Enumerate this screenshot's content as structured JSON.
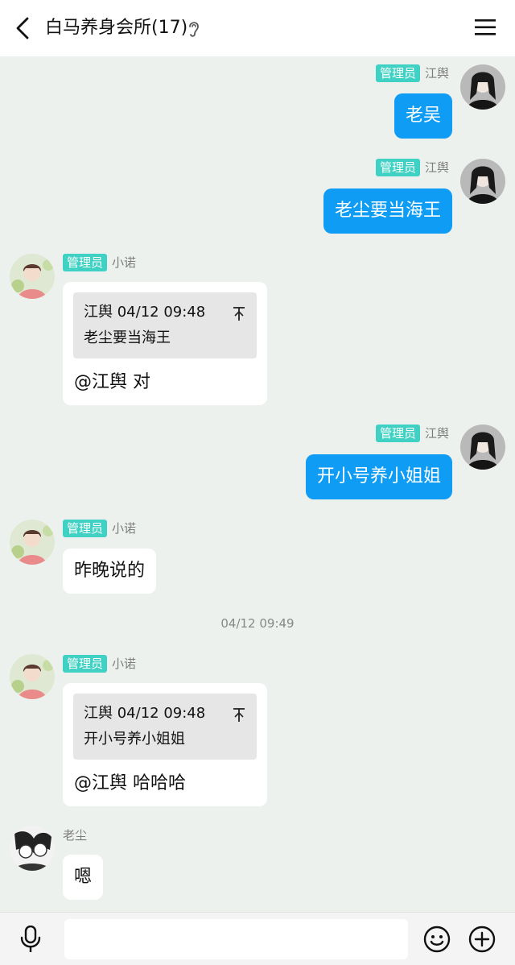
{
  "header": {
    "title": "白马养身会所(17)",
    "back_icon": "back-arrow-icon",
    "ear_icon": "ear-icon",
    "menu_icon": "menu-icon"
  },
  "messages": [
    {
      "side": "right",
      "badge": "管理员",
      "sender": "江舆",
      "text": "老吴"
    },
    {
      "side": "right",
      "badge": "管理员",
      "sender": "江舆",
      "text": "老尘要当海王"
    },
    {
      "side": "left",
      "badge": "管理员",
      "sender": "小诺",
      "quote_header": "江舆 04/12 09:48",
      "quote_text": "老尘要当海王",
      "text": "@江舆 对"
    },
    {
      "side": "right",
      "badge": "管理员",
      "sender": "江舆",
      "text": "开小号养小姐姐"
    },
    {
      "side": "left",
      "badge": "管理员",
      "sender": "小诺",
      "text": "昨晚说的"
    },
    {
      "side": "left",
      "badge": "管理员",
      "sender": "小诺",
      "quote_header": "江舆 04/12 09:48",
      "quote_text": "开小号养小姐姐",
      "text": "@江舆 哈哈哈"
    },
    {
      "side": "left",
      "badge": "",
      "sender": "老尘",
      "text": "嗯"
    }
  ],
  "timestamp": "04/12 09:49",
  "input": {
    "value": "",
    "placeholder": ""
  },
  "colors": {
    "accent_blue": "#0f9cf4",
    "badge_teal": "#3fd1c3",
    "chat_background": "#edf1ee"
  },
  "icons": {
    "mic": "microphone-icon",
    "emoji": "smiley-icon",
    "plus": "plus-icon",
    "quote": "quote-pin-icon"
  }
}
